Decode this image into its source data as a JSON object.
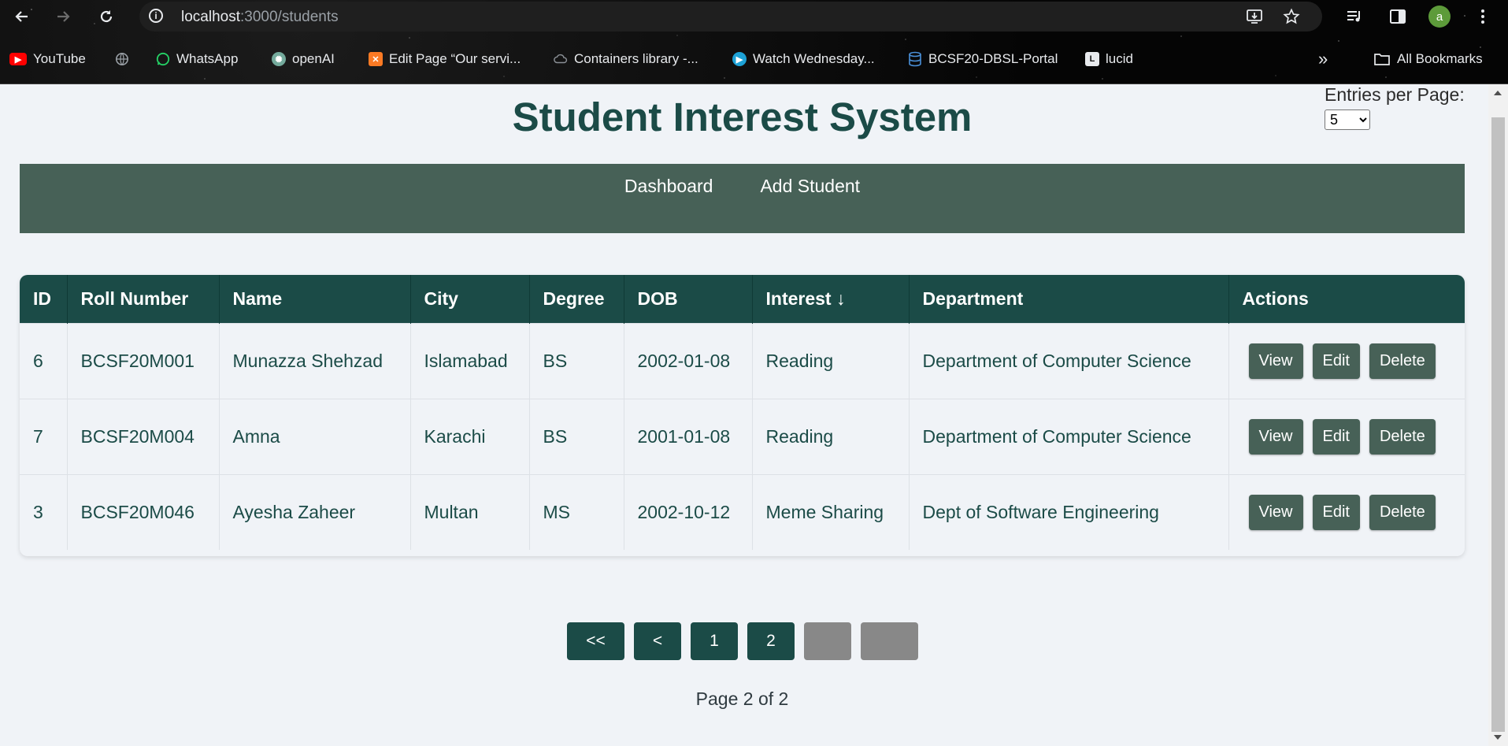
{
  "browser": {
    "url_host": "localhost",
    "url_path": ":3000/students",
    "avatar_letter": "a",
    "bookmarks": [
      {
        "label": "YouTube",
        "icon": "youtube-icon",
        "color": "#ff0000"
      },
      {
        "label": "",
        "icon": "globe-icon",
        "color": "#9aa0a6"
      },
      {
        "label": "WhatsApp",
        "icon": "whatsapp-icon",
        "color": "#25d366"
      },
      {
        "label": "openAI",
        "icon": "openai-icon",
        "color": "#74aa9c"
      },
      {
        "label": "Edit Page “Our servi...",
        "icon": "xampp-icon",
        "color": "#fb7a24"
      },
      {
        "label": "Containers library -...",
        "icon": "cloud-icon",
        "color": "#5f6368"
      },
      {
        "label": "Watch Wednesday...",
        "icon": "play-icon",
        "color": "#1da1d6"
      },
      {
        "label": "BCSF20-DBSL-Portal",
        "icon": "database-icon",
        "color": "#4a90d9"
      },
      {
        "label": "lucid",
        "icon": "lucid-icon",
        "color": "#2b2b2b"
      }
    ],
    "more_bookmarks": "»",
    "all_bookmarks": "All Bookmarks"
  },
  "header": {
    "title": "Student Interest System",
    "entries_label": "Entries per Page:",
    "entries_value": "5"
  },
  "nav": {
    "dashboard": "Dashboard",
    "add_student": "Add Student"
  },
  "table": {
    "headers": [
      "ID",
      "Roll Number",
      "Name",
      "City",
      "Degree",
      "DOB",
      "Interest ↓",
      "Department",
      "Actions"
    ],
    "rows": [
      [
        "6",
        "BCSF20M001",
        "Munazza Shehzad",
        "Islamabad",
        "BS",
        "2002-01-08",
        "Reading",
        "Department of Computer Science"
      ],
      [
        "7",
        "BCSF20M004",
        "Amna",
        "Karachi",
        "BS",
        "2001-01-08",
        "Reading",
        "Department of Computer Science"
      ],
      [
        "3",
        "BCSF20M046",
        "Ayesha Zaheer",
        "Multan",
        "MS",
        "2002-10-12",
        "Meme Sharing",
        "Dept of Software Engineering"
      ]
    ],
    "actions": {
      "view": "View",
      "edit": "Edit",
      "delete": "Delete"
    }
  },
  "pagination": {
    "first": "<<",
    "prev": "<",
    "pages": [
      "1",
      "2"
    ],
    "next": "",
    "last": "",
    "info": "Page 2 of 2"
  },
  "colors": {
    "title": "#1b4b47",
    "navbar": "#476157",
    "table_header": "#1b4b47",
    "button": "#476157",
    "disabled": "#888888"
  }
}
